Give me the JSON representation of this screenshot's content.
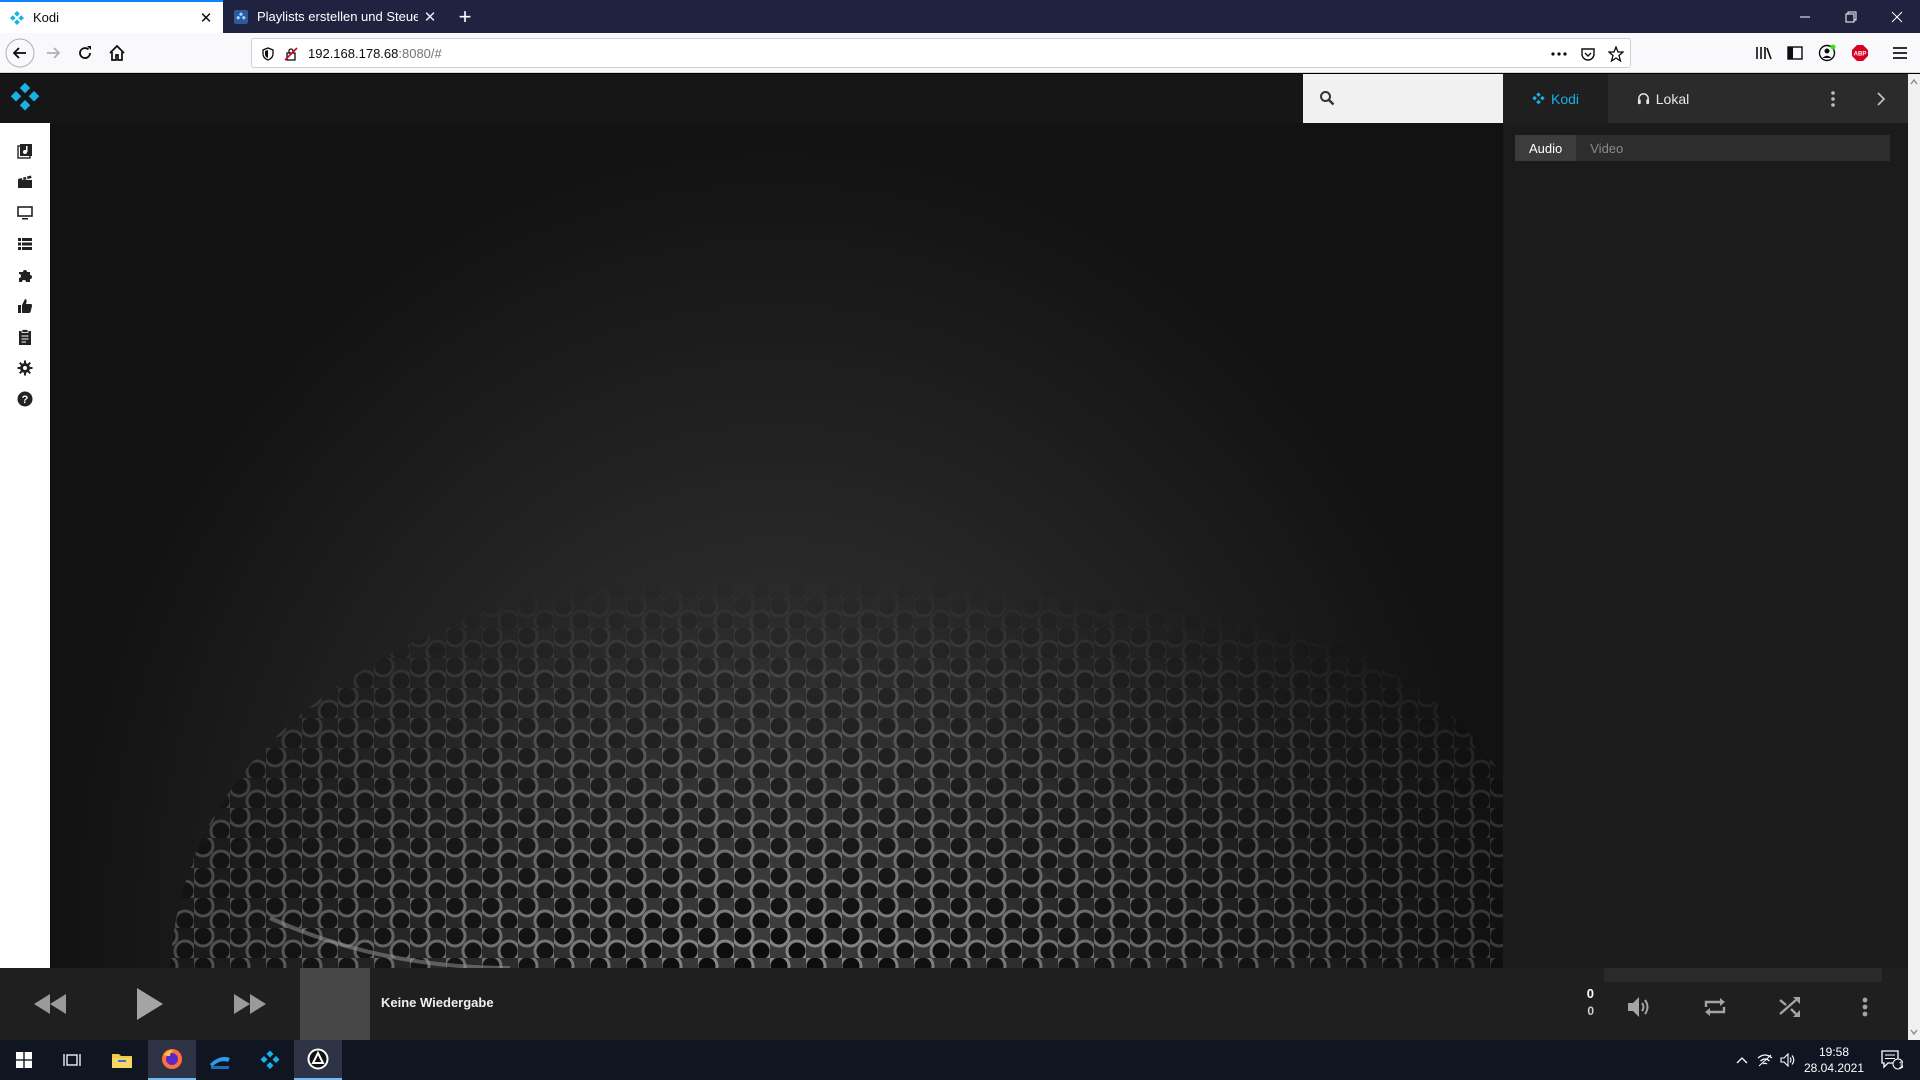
{
  "browser": {
    "tabs": [
      {
        "title": "Kodi",
        "active": true
      },
      {
        "title": "Playlists erstellen und Steuerun",
        "active": false
      }
    ],
    "url": {
      "host": "192.168.178.68",
      "rest": ":8080/#"
    }
  },
  "kodi": {
    "remote_tabs": {
      "kodi": "Kodi",
      "lokal": "Lokal"
    },
    "playlist_tabs": {
      "audio": "Audio",
      "video": "Video"
    },
    "now_playing": {
      "title": "Keine Wiedergabe",
      "time_current": "0",
      "time_total": "0"
    },
    "sidebar": [
      {
        "name": "music-icon"
      },
      {
        "name": "movies-icon"
      },
      {
        "name": "tv-icon"
      },
      {
        "name": "playlist-icon"
      },
      {
        "name": "addons-icon"
      },
      {
        "name": "thumbs-up-icon"
      },
      {
        "name": "clipboard-icon"
      },
      {
        "name": "settings-icon"
      },
      {
        "name": "help-icon"
      }
    ]
  },
  "taskbar": {
    "time": "19:58",
    "date": "28.04.2021",
    "notifications": "1"
  },
  "colors": {
    "kodi_blue": "#17b2e7",
    "tab_accent": "#0a84ff",
    "titlebar": "#202340"
  }
}
